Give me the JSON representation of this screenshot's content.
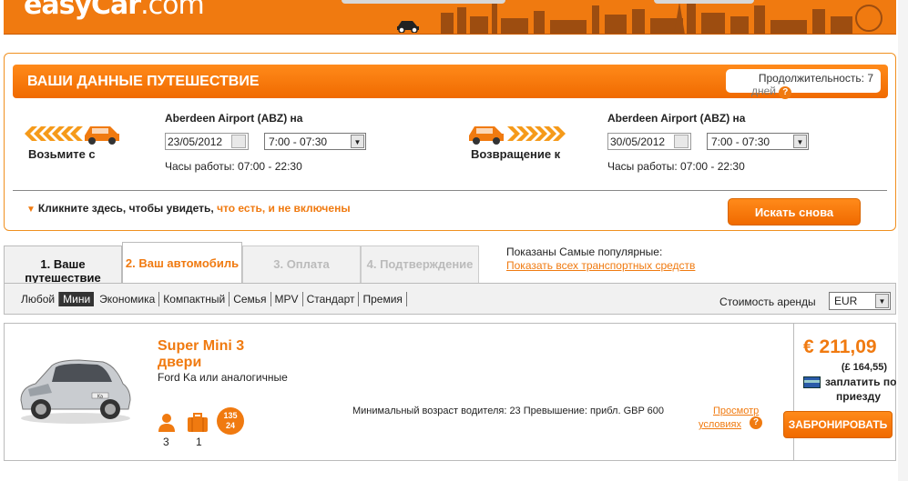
{
  "header": {
    "logo_main": "easyCar",
    "logo_tld": ".com"
  },
  "travel": {
    "title": "ВАШИ ДАННЫЕ ПУТЕШЕСТВИЕ",
    "duration_label": "Продолжительность: 7",
    "duration_unit": "дней",
    "pickup": {
      "label": "Возьмите с",
      "location": "Aberdeen Airport (ABZ) на",
      "date": "23/05/2012",
      "time": "7:00 - 07:30",
      "hours": "Часы работы: 07:00 - 22:30"
    },
    "return": {
      "label": "Возвращение к",
      "location": "Aberdeen Airport (ABZ) на",
      "date": "30/05/2012",
      "time": "7:00 - 07:30",
      "hours": "Часы работы: 07:00 - 22:30"
    },
    "click_here_text": "Кликните здесь, чтобы увидеть, ",
    "click_here_link": "что есть, и не включены",
    "search_again": "Искать снова"
  },
  "tabs": [
    {
      "label": "1. Ваше путешествие",
      "state": "done"
    },
    {
      "label": "2. Ваш автомобиль",
      "state": "active"
    },
    {
      "label": "3. Оплата",
      "state": "disabled"
    },
    {
      "label": "4. Подтверждение",
      "state": "disabled"
    }
  ],
  "popular": {
    "label": "Показаны Самые популярные:",
    "link": "Показать всех транспортных средств"
  },
  "filters": {
    "items": [
      "Любой",
      "Мини",
      "Экономика",
      "Компактный",
      "Семья",
      "MPV",
      "Стандарт",
      "Премия"
    ],
    "active": "Мини",
    "rental_cost_label": "Стоимость аренды",
    "currency": "EUR"
  },
  "car": {
    "name_line1": "Super Mini 3",
    "name_line2": "двери",
    "similar": "Ford Ka или аналогичные",
    "passengers": "3",
    "luggage": "1",
    "badge_top": "135",
    "badge_bottom": "24",
    "min_age": "Минимальный возраст водителя: 23 Превышение: прибл. GBP 600",
    "terms_link_line1": "Просмотр",
    "terms_link_line2": "условиях",
    "price_eur": "€ 211,09",
    "price_gbp": "(£ 164,55)",
    "pay_line1": "заплатить по",
    "pay_line2": "приезду",
    "book_label": "ЗАБРОНИРОВАТЬ",
    "image_model_label": "Ka"
  },
  "colors": {
    "accent": "#f07a10",
    "accent_dark": "#d86400"
  }
}
